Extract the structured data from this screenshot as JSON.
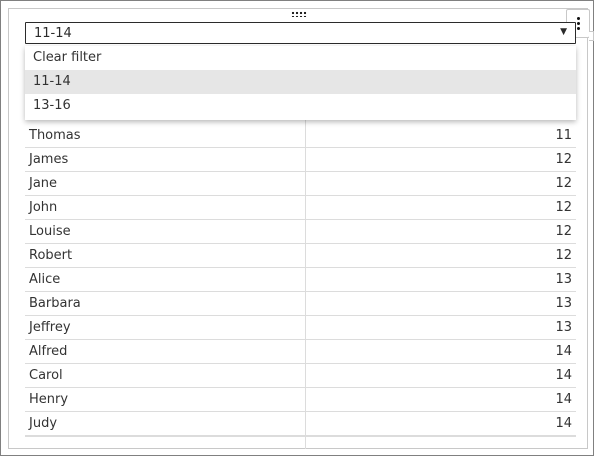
{
  "filter": {
    "selected": "11-14",
    "options": [
      {
        "label": "Clear filter",
        "highlighted": false
      },
      {
        "label": "11-14",
        "highlighted": true
      },
      {
        "label": "13-16",
        "highlighted": false
      }
    ]
  },
  "table": {
    "rows": [
      {
        "name": "Thomas",
        "age": "11"
      },
      {
        "name": "James",
        "age": "12"
      },
      {
        "name": "Jane",
        "age": "12"
      },
      {
        "name": "John",
        "age": "12"
      },
      {
        "name": "Louise",
        "age": "12"
      },
      {
        "name": "Robert",
        "age": "12"
      },
      {
        "name": "Alice",
        "age": "13"
      },
      {
        "name": "Barbara",
        "age": "13"
      },
      {
        "name": "Jeffrey",
        "age": "13"
      },
      {
        "name": "Alfred",
        "age": "14"
      },
      {
        "name": "Carol",
        "age": "14"
      },
      {
        "name": "Henry",
        "age": "14"
      },
      {
        "name": "Judy",
        "age": "14"
      }
    ]
  },
  "icons": {
    "drag": "drag-handle-icon",
    "menu": "more-vertical-icon",
    "caret": "caret-down-icon"
  }
}
